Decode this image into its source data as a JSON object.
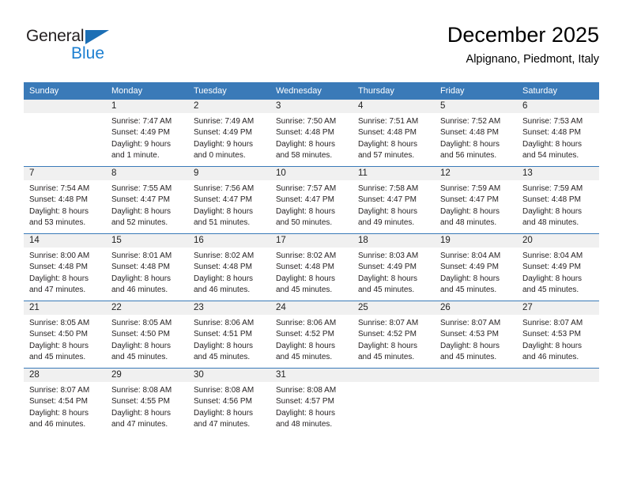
{
  "brand": {
    "name_top": "General",
    "name_bottom": "Blue",
    "triangle_color": "#1c6fb5",
    "blue_text_color": "#1c7fd1"
  },
  "header": {
    "title": "December 2025",
    "subtitle": "Alpignano, Piedmont, Italy"
  },
  "theme": {
    "header_row_bg": "#3a7ab8",
    "header_row_text": "#ffffff",
    "daynum_strip_bg": "#f0f0f0",
    "week_separator": "#3a7ab8",
    "body_text": "#231f20"
  },
  "weekday_headers": [
    "Sunday",
    "Monday",
    "Tuesday",
    "Wednesday",
    "Thursday",
    "Friday",
    "Saturday"
  ],
  "labels": {
    "sunrise_prefix": "Sunrise:",
    "sunset_prefix": "Sunset:",
    "daylight_prefix": "Daylight:"
  },
  "weeks": [
    [
      {
        "day": "",
        "blank": true,
        "sunrise": "",
        "sunset": "",
        "daylight_line1": "",
        "daylight_line2": ""
      },
      {
        "day": "1",
        "blank": false,
        "sunrise": "Sunrise: 7:47 AM",
        "sunset": "Sunset: 4:49 PM",
        "daylight_line1": "Daylight: 9 hours",
        "daylight_line2": "and 1 minute."
      },
      {
        "day": "2",
        "blank": false,
        "sunrise": "Sunrise: 7:49 AM",
        "sunset": "Sunset: 4:49 PM",
        "daylight_line1": "Daylight: 9 hours",
        "daylight_line2": "and 0 minutes."
      },
      {
        "day": "3",
        "blank": false,
        "sunrise": "Sunrise: 7:50 AM",
        "sunset": "Sunset: 4:48 PM",
        "daylight_line1": "Daylight: 8 hours",
        "daylight_line2": "and 58 minutes."
      },
      {
        "day": "4",
        "blank": false,
        "sunrise": "Sunrise: 7:51 AM",
        "sunset": "Sunset: 4:48 PM",
        "daylight_line1": "Daylight: 8 hours",
        "daylight_line2": "and 57 minutes."
      },
      {
        "day": "5",
        "blank": false,
        "sunrise": "Sunrise: 7:52 AM",
        "sunset": "Sunset: 4:48 PM",
        "daylight_line1": "Daylight: 8 hours",
        "daylight_line2": "and 56 minutes."
      },
      {
        "day": "6",
        "blank": false,
        "sunrise": "Sunrise: 7:53 AM",
        "sunset": "Sunset: 4:48 PM",
        "daylight_line1": "Daylight: 8 hours",
        "daylight_line2": "and 54 minutes."
      }
    ],
    [
      {
        "day": "7",
        "blank": false,
        "sunrise": "Sunrise: 7:54 AM",
        "sunset": "Sunset: 4:48 PM",
        "daylight_line1": "Daylight: 8 hours",
        "daylight_line2": "and 53 minutes."
      },
      {
        "day": "8",
        "blank": false,
        "sunrise": "Sunrise: 7:55 AM",
        "sunset": "Sunset: 4:47 PM",
        "daylight_line1": "Daylight: 8 hours",
        "daylight_line2": "and 52 minutes."
      },
      {
        "day": "9",
        "blank": false,
        "sunrise": "Sunrise: 7:56 AM",
        "sunset": "Sunset: 4:47 PM",
        "daylight_line1": "Daylight: 8 hours",
        "daylight_line2": "and 51 minutes."
      },
      {
        "day": "10",
        "blank": false,
        "sunrise": "Sunrise: 7:57 AM",
        "sunset": "Sunset: 4:47 PM",
        "daylight_line1": "Daylight: 8 hours",
        "daylight_line2": "and 50 minutes."
      },
      {
        "day": "11",
        "blank": false,
        "sunrise": "Sunrise: 7:58 AM",
        "sunset": "Sunset: 4:47 PM",
        "daylight_line1": "Daylight: 8 hours",
        "daylight_line2": "and 49 minutes."
      },
      {
        "day": "12",
        "blank": false,
        "sunrise": "Sunrise: 7:59 AM",
        "sunset": "Sunset: 4:47 PM",
        "daylight_line1": "Daylight: 8 hours",
        "daylight_line2": "and 48 minutes."
      },
      {
        "day": "13",
        "blank": false,
        "sunrise": "Sunrise: 7:59 AM",
        "sunset": "Sunset: 4:48 PM",
        "daylight_line1": "Daylight: 8 hours",
        "daylight_line2": "and 48 minutes."
      }
    ],
    [
      {
        "day": "14",
        "blank": false,
        "sunrise": "Sunrise: 8:00 AM",
        "sunset": "Sunset: 4:48 PM",
        "daylight_line1": "Daylight: 8 hours",
        "daylight_line2": "and 47 minutes."
      },
      {
        "day": "15",
        "blank": false,
        "sunrise": "Sunrise: 8:01 AM",
        "sunset": "Sunset: 4:48 PM",
        "daylight_line1": "Daylight: 8 hours",
        "daylight_line2": "and 46 minutes."
      },
      {
        "day": "16",
        "blank": false,
        "sunrise": "Sunrise: 8:02 AM",
        "sunset": "Sunset: 4:48 PM",
        "daylight_line1": "Daylight: 8 hours",
        "daylight_line2": "and 46 minutes."
      },
      {
        "day": "17",
        "blank": false,
        "sunrise": "Sunrise: 8:02 AM",
        "sunset": "Sunset: 4:48 PM",
        "daylight_line1": "Daylight: 8 hours",
        "daylight_line2": "and 45 minutes."
      },
      {
        "day": "18",
        "blank": false,
        "sunrise": "Sunrise: 8:03 AM",
        "sunset": "Sunset: 4:49 PM",
        "daylight_line1": "Daylight: 8 hours",
        "daylight_line2": "and 45 minutes."
      },
      {
        "day": "19",
        "blank": false,
        "sunrise": "Sunrise: 8:04 AM",
        "sunset": "Sunset: 4:49 PM",
        "daylight_line1": "Daylight: 8 hours",
        "daylight_line2": "and 45 minutes."
      },
      {
        "day": "20",
        "blank": false,
        "sunrise": "Sunrise: 8:04 AM",
        "sunset": "Sunset: 4:49 PM",
        "daylight_line1": "Daylight: 8 hours",
        "daylight_line2": "and 45 minutes."
      }
    ],
    [
      {
        "day": "21",
        "blank": false,
        "sunrise": "Sunrise: 8:05 AM",
        "sunset": "Sunset: 4:50 PM",
        "daylight_line1": "Daylight: 8 hours",
        "daylight_line2": "and 45 minutes."
      },
      {
        "day": "22",
        "blank": false,
        "sunrise": "Sunrise: 8:05 AM",
        "sunset": "Sunset: 4:50 PM",
        "daylight_line1": "Daylight: 8 hours",
        "daylight_line2": "and 45 minutes."
      },
      {
        "day": "23",
        "blank": false,
        "sunrise": "Sunrise: 8:06 AM",
        "sunset": "Sunset: 4:51 PM",
        "daylight_line1": "Daylight: 8 hours",
        "daylight_line2": "and 45 minutes."
      },
      {
        "day": "24",
        "blank": false,
        "sunrise": "Sunrise: 8:06 AM",
        "sunset": "Sunset: 4:52 PM",
        "daylight_line1": "Daylight: 8 hours",
        "daylight_line2": "and 45 minutes."
      },
      {
        "day": "25",
        "blank": false,
        "sunrise": "Sunrise: 8:07 AM",
        "sunset": "Sunset: 4:52 PM",
        "daylight_line1": "Daylight: 8 hours",
        "daylight_line2": "and 45 minutes."
      },
      {
        "day": "26",
        "blank": false,
        "sunrise": "Sunrise: 8:07 AM",
        "sunset": "Sunset: 4:53 PM",
        "daylight_line1": "Daylight: 8 hours",
        "daylight_line2": "and 45 minutes."
      },
      {
        "day": "27",
        "blank": false,
        "sunrise": "Sunrise: 8:07 AM",
        "sunset": "Sunset: 4:53 PM",
        "daylight_line1": "Daylight: 8 hours",
        "daylight_line2": "and 46 minutes."
      }
    ],
    [
      {
        "day": "28",
        "blank": false,
        "sunrise": "Sunrise: 8:07 AM",
        "sunset": "Sunset: 4:54 PM",
        "daylight_line1": "Daylight: 8 hours",
        "daylight_line2": "and 46 minutes."
      },
      {
        "day": "29",
        "blank": false,
        "sunrise": "Sunrise: 8:08 AM",
        "sunset": "Sunset: 4:55 PM",
        "daylight_line1": "Daylight: 8 hours",
        "daylight_line2": "and 47 minutes."
      },
      {
        "day": "30",
        "blank": false,
        "sunrise": "Sunrise: 8:08 AM",
        "sunset": "Sunset: 4:56 PM",
        "daylight_line1": "Daylight: 8 hours",
        "daylight_line2": "and 47 minutes."
      },
      {
        "day": "31",
        "blank": false,
        "sunrise": "Sunrise: 8:08 AM",
        "sunset": "Sunset: 4:57 PM",
        "daylight_line1": "Daylight: 8 hours",
        "daylight_line2": "and 48 minutes."
      },
      {
        "day": "",
        "blank": true,
        "sunrise": "",
        "sunset": "",
        "daylight_line1": "",
        "daylight_line2": ""
      },
      {
        "day": "",
        "blank": true,
        "sunrise": "",
        "sunset": "",
        "daylight_line1": "",
        "daylight_line2": ""
      },
      {
        "day": "",
        "blank": true,
        "sunrise": "",
        "sunset": "",
        "daylight_line1": "",
        "daylight_line2": ""
      }
    ]
  ]
}
